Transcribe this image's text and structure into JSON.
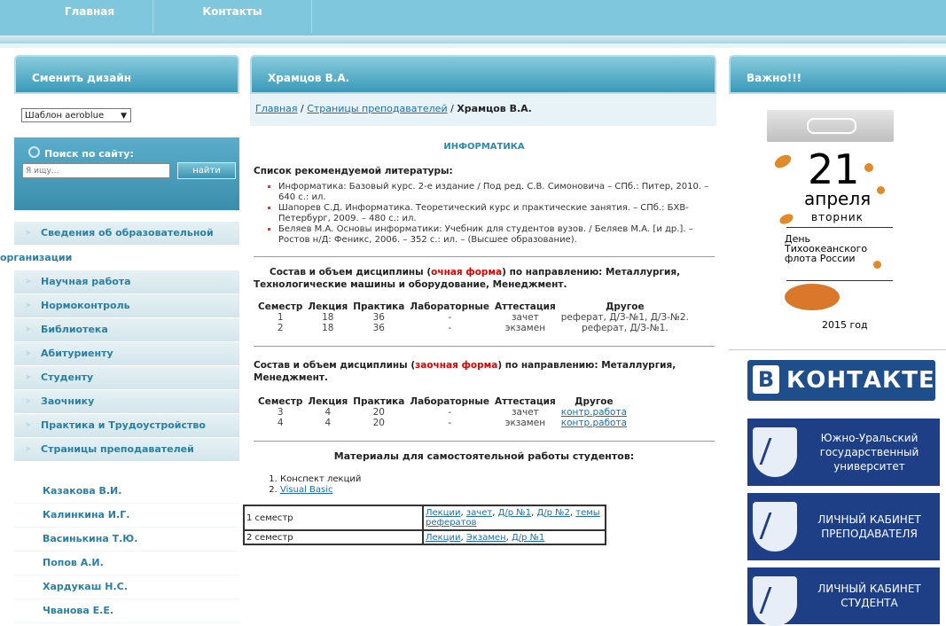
{
  "topnav": {
    "home": "Главная",
    "contacts": "Контакты"
  },
  "left": {
    "design_title": "Сменить дизайн",
    "template_select": "Шаблон aeroblue",
    "search_title": "Поиск по сайту:",
    "search_placeholder": "Я ищу...",
    "search_button": "найти",
    "menu": [
      "Сведения об образовательной",
      "организации",
      "Научная работа",
      "Нормоконтроль",
      "Библиотека",
      "Абитуриенту",
      "Студенту",
      "Заочнику",
      "Практика и Трудоустройство",
      "Страницы преподавателей"
    ],
    "teachers": [
      "Казакова В.И.",
      "Калинкина И.Г.",
      "Васинькина Т.Ю.",
      "Попов А.И.",
      "Хардукаш Н.С.",
      "Чванова Е.Е."
    ]
  },
  "center": {
    "title": "Храмцов В.А.",
    "crumb": {
      "home": "Главная",
      "sep1": " / ",
      "teachers": "Страницы преподавателей",
      "sep2": " / ",
      "current": "Храмцов В.А."
    },
    "subject": "ИНФОРМАТИКА",
    "lit_title": "Список рекомендуемой литературы:",
    "lit": [
      "Информатика: Базовый курс. 2-е издание / Под ред. С.В. Симоновича – СПб.: Питер, 2010. – 640 с.: ил.",
      "Шапорев С.Д. Информатика. Теоретический курс и практические занятия. – СПб.: БХВ-Петербург, 2009. – 480 с.: ил.",
      "Беляев М.А. Основы информатики: Учебник для студентов вузов. / Беляев М.А. [и др.]. – Ростов н/Д: Феникс, 2006. – 352 с.: ил. – (Высшее образование)."
    ],
    "full": {
      "pre": "Состав и объем дисциплины (",
      "form": "очная форма",
      "post": ") по направлению: Металлургия, Технологические машины и оборудование, Менеджмент."
    },
    "headers": [
      "Семестр",
      "Лекция",
      "Практика",
      "Лабораторные",
      "Аттестация",
      "Другое"
    ],
    "full_rows": [
      [
        "1",
        "18",
        "36",
        "-",
        "зачет",
        "реферат, Д/З-№1, Д/З-№2."
      ],
      [
        "2",
        "18",
        "36",
        "-",
        "экзамен",
        "реферат, Д/З-№1."
      ]
    ],
    "part": {
      "pre": "Состав и объем дисциплины (",
      "form": "заочная форма",
      "post": ") по направлению: Металлургия, Менеджмент."
    },
    "part_rows": [
      [
        "3",
        "4",
        "20",
        "-",
        "зачет",
        "контр.работа"
      ],
      [
        "4",
        "4",
        "20",
        "-",
        "экзамен",
        "контр.работа"
      ]
    ],
    "materials_title": "Материалы для самостоятельной работы студентов:",
    "materials": [
      "Конспект лекций",
      "Visual Basic"
    ],
    "sem1": {
      "label": "1 семестр",
      "l1": "Лекции",
      "c1": ", ",
      "l2": "зачет",
      "c2": ", ",
      "l3": "Д/р №1",
      "c3": ", ",
      "l4": "Д/р №2",
      "c4": ", ",
      "l5": "темы рефератов"
    },
    "sem2": {
      "label": "2 семестр",
      "l1": "Лекции",
      "c1": ", ",
      "l2": "Экзамен",
      "c2": ", ",
      "l3": "Д/р №1"
    }
  },
  "right": {
    "title": "Важно!!!",
    "calendar": {
      "day": "21",
      "month": "апреля",
      "weekday": "вторник",
      "holiday": "День Тихоокеанского флота России",
      "year": "2015 год"
    },
    "vk": {
      "letter": "B",
      "text": "КОНТАКТЕ"
    },
    "banners": [
      "Южно-Уральский государственный университет",
      "ЛИЧНЫЙ КАБИНЕТ ПРЕПОДАВАТЕЛЯ",
      "ЛИЧНЫЙ КАБИНЕТ СТУДЕНТА"
    ]
  }
}
